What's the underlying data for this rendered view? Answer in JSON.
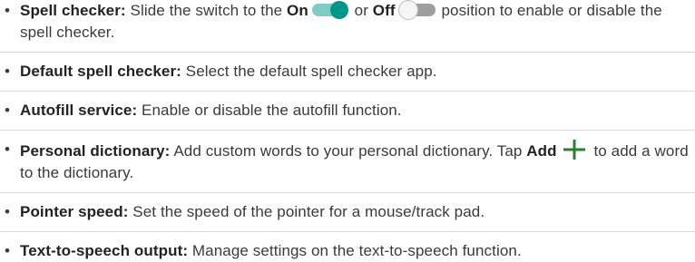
{
  "items": [
    {
      "term": "Spell checker:",
      "text_a": " Slide the switch to the ",
      "on_label": "On",
      "text_b": " or ",
      "off_label": "Off",
      "text_c": " position to enable or disable the spell checker."
    },
    {
      "term": "Default spell checker:",
      "text": " Select the default spell checker app."
    },
    {
      "term": "Autofill service:",
      "text": " Enable or disable the autofill function."
    },
    {
      "term": "Personal dictionary:",
      "text_a": " Add custom words to your personal dictionary. Tap ",
      "add_label": "Add",
      "text_b": " to add a word to the dictionary."
    },
    {
      "term": "Pointer speed:",
      "text": " Set the speed of the pointer for a mouse/track pad."
    },
    {
      "term": "Text-to-speech output:",
      "text": " Manage settings on the text-to-speech function."
    }
  ],
  "icons": {
    "toggle_on": "toggle-on-icon",
    "toggle_off": "toggle-off-icon",
    "add": "plus-icon"
  },
  "colors": {
    "toggle_on_knob": "#009688",
    "toggle_on_track": "#80cbc4",
    "toggle_off_track": "#9e9e9e",
    "separator": "#d8d8d8"
  }
}
